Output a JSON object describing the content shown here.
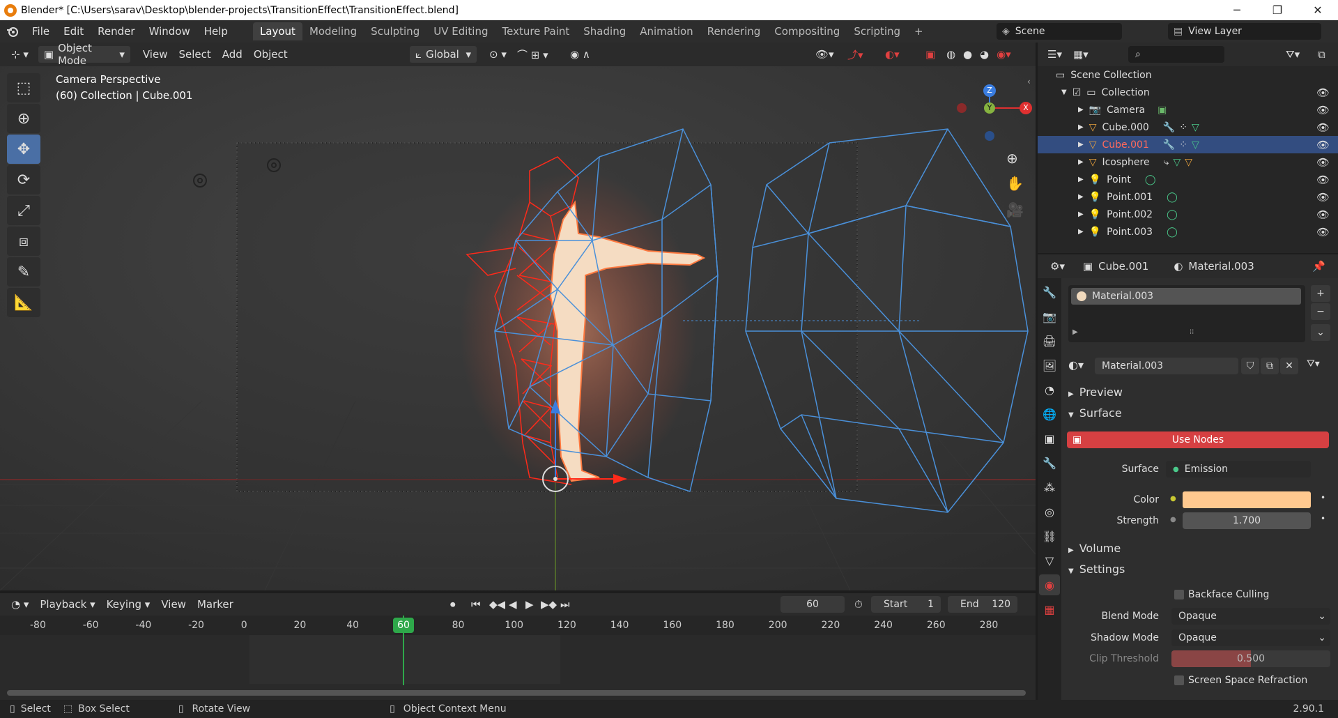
{
  "window": {
    "title": "Blender* [C:\\Users\\sarav\\Desktop\\blender-projects\\TransitionEffect\\TransitionEffect.blend]",
    "minimize": "─",
    "maximize": "❐",
    "close": "✕"
  },
  "menu": {
    "items": [
      "File",
      "Edit",
      "Render",
      "Window",
      "Help"
    ],
    "workspaces": [
      "Layout",
      "Modeling",
      "Sculpting",
      "UV Editing",
      "Texture Paint",
      "Shading",
      "Animation",
      "Rendering",
      "Compositing",
      "Scripting"
    ],
    "add_workspace": "+",
    "scene_label": "Scene",
    "view_layer_label": "View Layer"
  },
  "viewport_header": {
    "mode": "Object Mode",
    "view": "View",
    "select": "Select",
    "add": "Add",
    "object": "Object",
    "transform_orientation": "Global"
  },
  "viewport": {
    "camera_label": "Camera Perspective",
    "collection_label": "(60) Collection | Cube.001",
    "gizmo_z": "Z",
    "gizmo_y": "Y",
    "gizmo_x": "X"
  },
  "timeline": {
    "playback": "Playback",
    "keying": "Keying",
    "view": "View",
    "marker": "Marker",
    "current_frame": "60",
    "start_label": "Start",
    "start_value": "1",
    "end_label": "End",
    "end_value": "120",
    "ruler": [
      "-80",
      "-60",
      "-40",
      "-20",
      "0",
      "20",
      "40",
      "60",
      "80",
      "100",
      "120",
      "140",
      "160",
      "180",
      "200",
      "220",
      "240",
      "260",
      "280"
    ]
  },
  "statusbar": {
    "select": "Select",
    "box_select": "Box Select",
    "rotate_view": "Rotate View",
    "context_menu": "Object Context Menu",
    "version": "2.90.1"
  },
  "outliner": {
    "scene_collection": "Scene Collection",
    "collection": "Collection",
    "items": [
      {
        "name": "Camera",
        "color": "#e8a23d"
      },
      {
        "name": "Cube.000",
        "color": "#e8a23d"
      },
      {
        "name": "Cube.001",
        "color": "#ff6a5c"
      },
      {
        "name": "Icosphere",
        "color": "#e8a23d"
      },
      {
        "name": "Point",
        "color": "#e8a23d"
      },
      {
        "name": "Point.001",
        "color": "#e8a23d"
      },
      {
        "name": "Point.002",
        "color": "#e8a23d"
      },
      {
        "name": "Point.003",
        "color": "#e8a23d"
      }
    ]
  },
  "properties": {
    "object_name": "Cube.001",
    "material_name": "Material.003",
    "slot_name": "Material.003",
    "datablock_name": "Material.003",
    "preview": "Preview",
    "surface_panel": "Surface",
    "use_nodes": "Use Nodes",
    "surface_label": "Surface",
    "surface_value": "Emission",
    "color_label": "Color",
    "color_value": "#ffc98f",
    "strength_label": "Strength",
    "strength_value": "1.700",
    "volume_panel": "Volume",
    "settings_panel": "Settings",
    "backface_culling": "Backface Culling",
    "blend_mode_label": "Blend Mode",
    "blend_mode_value": "Opaque",
    "shadow_mode_label": "Shadow Mode",
    "shadow_mode_value": "Opaque",
    "clip_threshold_label": "Clip Threshold",
    "clip_threshold_value": "0.500",
    "ssr": "Screen Space Refraction"
  }
}
